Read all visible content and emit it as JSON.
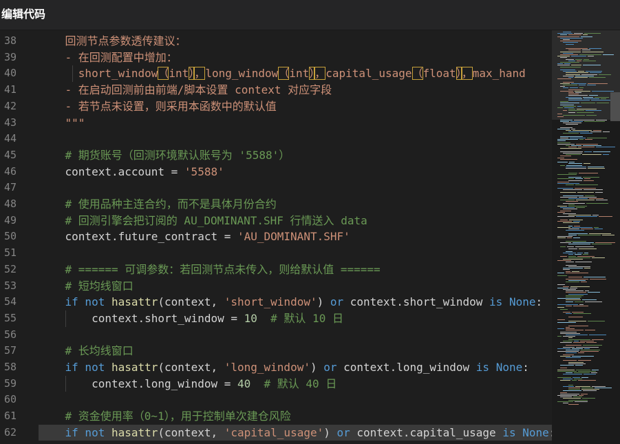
{
  "window": {
    "title": "编辑代码"
  },
  "editor": {
    "lines": [
      {
        "no": "38",
        "tokens": [
          {
            "t": "    回测节点参数透传建议：",
            "c": "docstr"
          }
        ]
      },
      {
        "no": "39",
        "tokens": [
          {
            "t": "    - 在回测配置中增加：",
            "c": "docstr"
          }
        ]
      },
      {
        "no": "40",
        "tokens": [
          {
            "t": "      short_window",
            "c": "docstr"
          },
          {
            "t": "（",
            "c": "hl"
          },
          {
            "t": "int",
            "c": "docstr"
          },
          {
            "t": "）",
            "c": "hl"
          },
          {
            "t": "，",
            "c": "hl"
          },
          {
            "t": "long_window",
            "c": "docstr"
          },
          {
            "t": "（",
            "c": "hl"
          },
          {
            "t": "int",
            "c": "docstr"
          },
          {
            "t": "）",
            "c": "hl"
          },
          {
            "t": "，",
            "c": "hl"
          },
          {
            "t": "capital_usage",
            "c": "docstr"
          },
          {
            "t": "（",
            "c": "hl"
          },
          {
            "t": "float",
            "c": "docstr"
          },
          {
            "t": "）",
            "c": "hl"
          },
          {
            "t": "，",
            "c": "hl"
          },
          {
            "t": "max_hand",
            "c": "docstr"
          }
        ]
      },
      {
        "no": "41",
        "tokens": [
          {
            "t": "    - 在启动回测前由前端/脚本设置 context 对应字段",
            "c": "docstr"
          }
        ]
      },
      {
        "no": "42",
        "tokens": [
          {
            "t": "    - 若节点未设置，则采用本函数中的默认值",
            "c": "docstr"
          }
        ]
      },
      {
        "no": "43",
        "tokens": [
          {
            "t": "    \"\"\"",
            "c": "docstr"
          }
        ]
      },
      {
        "no": "44",
        "tokens": []
      },
      {
        "no": "45",
        "tokens": [
          {
            "t": "    # 期货账号（回测环境默认账号为 '5588'）",
            "c": "comment"
          }
        ]
      },
      {
        "no": "46",
        "tokens": [
          {
            "t": "    context.account = ",
            "c": "plain"
          },
          {
            "t": "'5588'",
            "c": "string"
          }
        ]
      },
      {
        "no": "47",
        "tokens": []
      },
      {
        "no": "48",
        "tokens": [
          {
            "t": "    # 使用品种主连合约，而不是具体月份合约",
            "c": "comment"
          }
        ]
      },
      {
        "no": "49",
        "tokens": [
          {
            "t": "    # 回测引擎会把订阅的 AU_DOMINANT.SHF 行情送入 data",
            "c": "comment"
          }
        ]
      },
      {
        "no": "50",
        "tokens": [
          {
            "t": "    context.future_contract = ",
            "c": "plain"
          },
          {
            "t": "'AU_DOMINANT.SHF'",
            "c": "string"
          }
        ]
      },
      {
        "no": "51",
        "tokens": []
      },
      {
        "no": "52",
        "tokens": [
          {
            "t": "    # ====== 可调参数：若回测节点未传入，则给默认值 ======",
            "c": "comment"
          }
        ]
      },
      {
        "no": "53",
        "tokens": [
          {
            "t": "    # 短均线窗口",
            "c": "comment"
          }
        ]
      },
      {
        "no": "54",
        "tokens": [
          {
            "t": "    ",
            "c": "plain"
          },
          {
            "t": "if not ",
            "c": "keyword"
          },
          {
            "t": "hasattr",
            "c": "builtin"
          },
          {
            "t": "(context, ",
            "c": "plain"
          },
          {
            "t": "'short_window'",
            "c": "string"
          },
          {
            "t": ") ",
            "c": "plain"
          },
          {
            "t": "or",
            "c": "keyword"
          },
          {
            "t": " context.short_window ",
            "c": "plain"
          },
          {
            "t": "is None",
            "c": "keyword"
          },
          {
            "t": ":",
            "c": "plain"
          }
        ]
      },
      {
        "no": "55",
        "tokens": [
          {
            "t": "        context.short_window = ",
            "c": "plain"
          },
          {
            "t": "10",
            "c": "number"
          },
          {
            "t": "  # 默认 10 日",
            "c": "comment"
          }
        ]
      },
      {
        "no": "56",
        "tokens": []
      },
      {
        "no": "57",
        "tokens": [
          {
            "t": "    # 长均线窗口",
            "c": "comment"
          }
        ]
      },
      {
        "no": "58",
        "tokens": [
          {
            "t": "    ",
            "c": "plain"
          },
          {
            "t": "if not ",
            "c": "keyword"
          },
          {
            "t": "hasattr",
            "c": "builtin"
          },
          {
            "t": "(context, ",
            "c": "plain"
          },
          {
            "t": "'long_window'",
            "c": "string"
          },
          {
            "t": ") ",
            "c": "plain"
          },
          {
            "t": "or",
            "c": "keyword"
          },
          {
            "t": " context.long_window ",
            "c": "plain"
          },
          {
            "t": "is None",
            "c": "keyword"
          },
          {
            "t": ":",
            "c": "plain"
          }
        ]
      },
      {
        "no": "59",
        "tokens": [
          {
            "t": "        context.long_window = ",
            "c": "plain"
          },
          {
            "t": "40",
            "c": "number"
          },
          {
            "t": "  # 默认 40 日",
            "c": "comment"
          }
        ]
      },
      {
        "no": "60",
        "tokens": []
      },
      {
        "no": "61",
        "tokens": [
          {
            "t": "    # 资金使用率（0~1），用于控制单次建仓风险",
            "c": "comment"
          }
        ]
      },
      {
        "no": "62",
        "current": true,
        "tokens": [
          {
            "t": "    ",
            "c": "plain"
          },
          {
            "t": "if not ",
            "c": "keyword"
          },
          {
            "t": "hasattr",
            "c": "builtin"
          },
          {
            "t": "(context, ",
            "c": "plain"
          },
          {
            "t": "'capital_usage'",
            "c": "string"
          },
          {
            "t": ") ",
            "c": "plain"
          },
          {
            "t": "or",
            "c": "keyword"
          },
          {
            "t": " context.capital_usage ",
            "c": "plain"
          },
          {
            "t": "is None",
            "c": "keyword"
          },
          {
            "t": ":",
            "c": "plain"
          }
        ]
      }
    ]
  },
  "colors": {
    "background": "#1e1e1e",
    "titlebar": "#252526",
    "docstring": "#ce9178",
    "comment": "#6a9955",
    "keyword": "#569cd6",
    "builtin": "#dcdcaa",
    "number": "#b5cea8",
    "highlight_border": "#c8a13a"
  }
}
